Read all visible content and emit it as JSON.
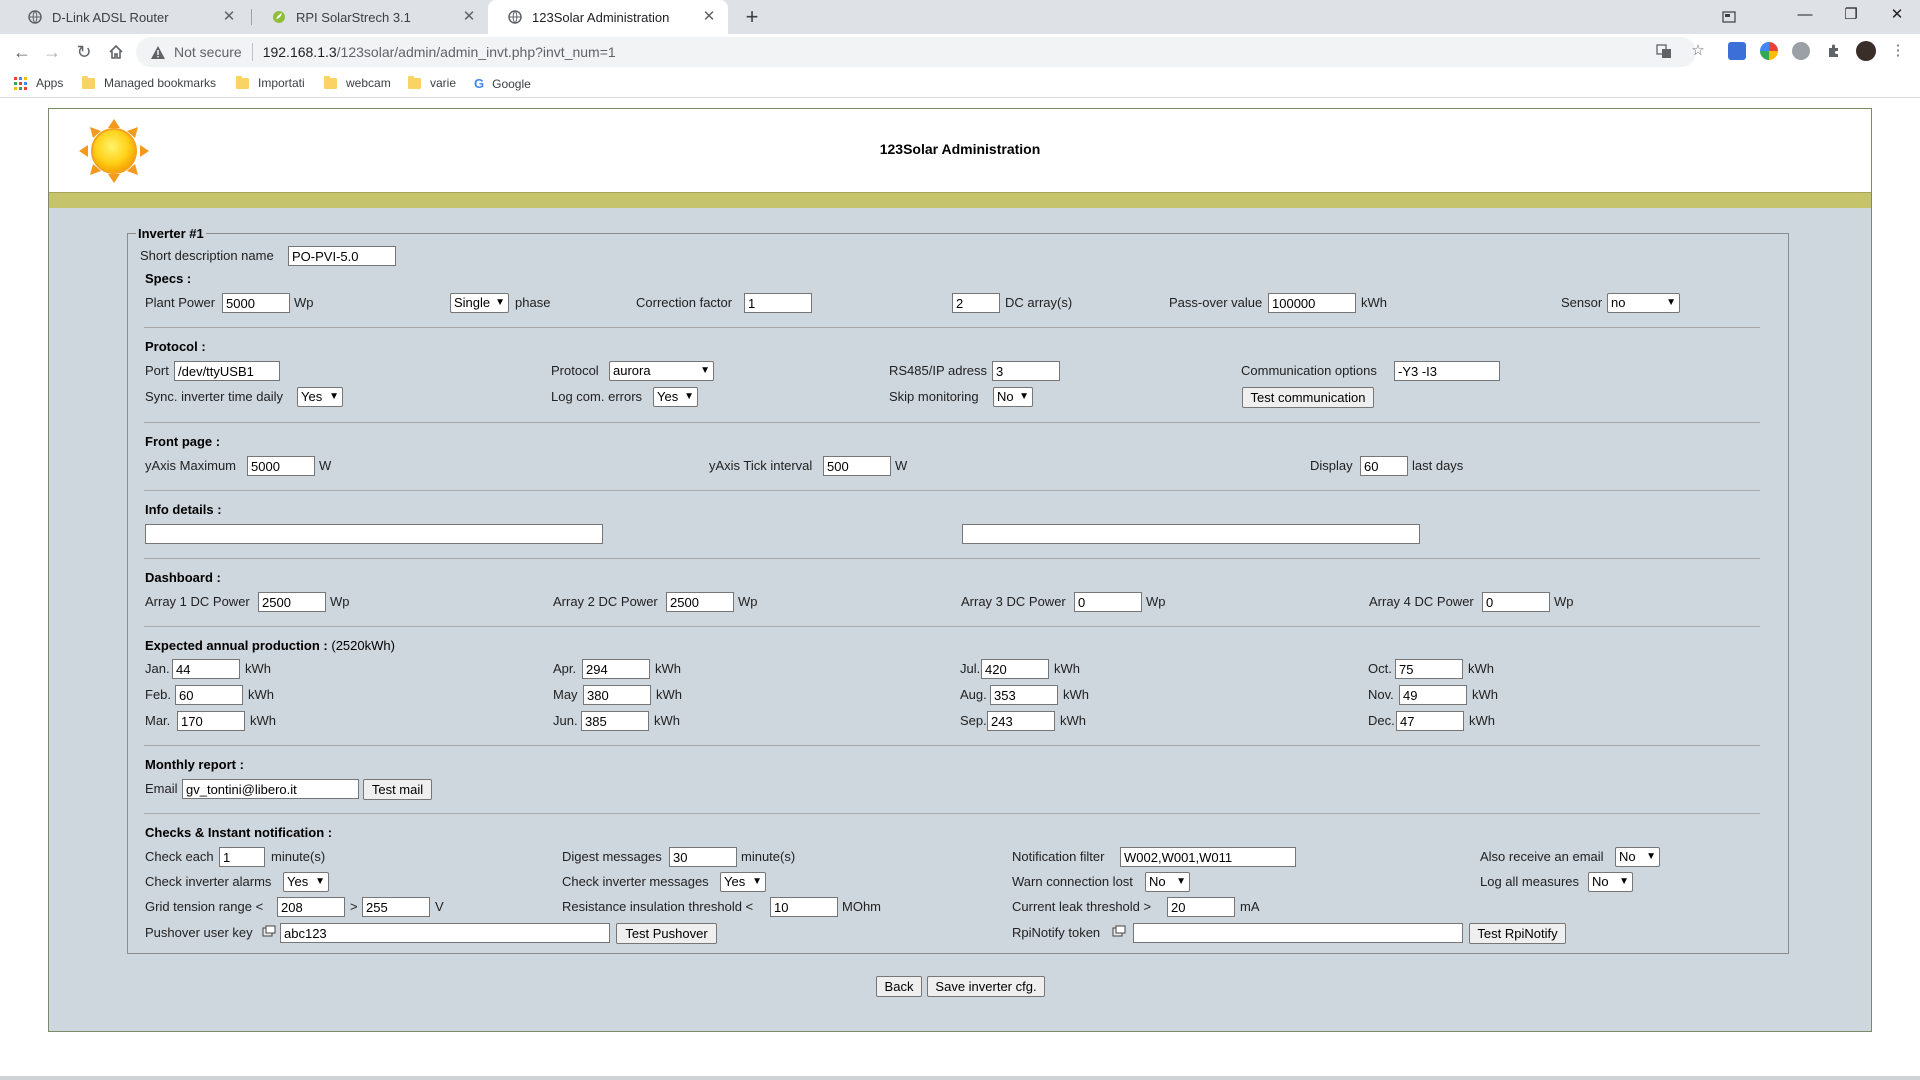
{
  "browser": {
    "tabs": [
      {
        "title": "D-Link ADSL Router",
        "active": false
      },
      {
        "title": "RPI SolarStrech 3.1",
        "active": false
      },
      {
        "title": "123Solar Administration",
        "active": true
      }
    ],
    "address": {
      "security": "Not secure",
      "host": "192.168.1.3",
      "path": "/123solar/admin/admin_invt.php?invt_num=1"
    },
    "bookmarks": [
      "Apps",
      "Managed bookmarks",
      "Importati",
      "webcam",
      "varie",
      "Google"
    ]
  },
  "page": {
    "title": "123Solar Administration",
    "legend": "Inverter #1",
    "short_desc": {
      "label": "Short description name",
      "value": "PO-PVI-5.0"
    },
    "specs": {
      "title": "Specs :",
      "plant_power_label": "Plant Power",
      "plant_power": "5000",
      "plant_power_unit": "Wp",
      "phase_value": "Single",
      "phase_label": "phase",
      "correction_label": "Correction factor",
      "correction": "1",
      "dc_arrays": "2",
      "dc_arrays_label": "DC array(s)",
      "passover_label": "Pass-over value",
      "passover": "100000",
      "passover_unit": "kWh",
      "sensor_label": "Sensor",
      "sensor": "no"
    },
    "protocol": {
      "title": "Protocol :",
      "port_label": "Port",
      "port": "/dev/ttyUSB1",
      "protocol_label": "Protocol",
      "protocol": "aurora",
      "rs485_label": "RS485/IP adress",
      "rs485": "3",
      "comm_label": "Communication options",
      "comm": "-Y3 -I3",
      "sync_label": "Sync. inverter time daily",
      "sync": "Yes",
      "log_label": "Log com. errors",
      "log": "Yes",
      "skip_label": "Skip monitoring",
      "skip": "No",
      "test_button": "Test communication"
    },
    "front": {
      "title": "Front page :",
      "ymax_label": "yAxis Maximum",
      "ymax": "5000",
      "ymax_unit": "W",
      "ytick_label": "yAxis Tick interval",
      "ytick": "500",
      "ytick_unit": "W",
      "display_label": "Display",
      "display": "60",
      "display_unit": "last days"
    },
    "info": {
      "title": "Info details :",
      "field1": "",
      "field2": ""
    },
    "dashboard": {
      "title": "Dashboard :",
      "arrays": [
        {
          "label": "Array 1 DC Power",
          "value": "2500",
          "unit": "Wp"
        },
        {
          "label": "Array 2 DC Power",
          "value": "2500",
          "unit": "Wp"
        },
        {
          "label": "Array 3 DC Power",
          "value": "0",
          "unit": "Wp"
        },
        {
          "label": "Array 4 DC Power",
          "value": "0",
          "unit": "Wp"
        }
      ]
    },
    "production": {
      "title": "Expected annual production :",
      "total": "(2520kWh)",
      "unit": "kWh",
      "months": [
        {
          "label": "Jan.",
          "value": "44"
        },
        {
          "label": "Feb.",
          "value": "60"
        },
        {
          "label": "Mar.",
          "value": "170"
        },
        {
          "label": "Apr.",
          "value": "294"
        },
        {
          "label": "May",
          "value": "380"
        },
        {
          "label": "Jun.",
          "value": "385"
        },
        {
          "label": "Jul.",
          "value": "420"
        },
        {
          "label": "Aug.",
          "value": "353"
        },
        {
          "label": "Sep.",
          "value": "243"
        },
        {
          "label": "Oct.",
          "value": "75"
        },
        {
          "label": "Nov.",
          "value": "49"
        },
        {
          "label": "Dec.",
          "value": "47"
        }
      ]
    },
    "monthly": {
      "title": "Monthly report :",
      "email_label": "Email",
      "email": "gv_tontini@libero.it",
      "test_button": "Test mail"
    },
    "checks": {
      "title": "Checks & Instant notification :",
      "check_each_label": "Check each",
      "check_each": "1",
      "check_each_unit": "minute(s)",
      "digest_label": "Digest messages",
      "digest": "30",
      "digest_unit": "minute(s)",
      "filter_label": "Notification filter",
      "filter": "W002,W001,W011",
      "also_email_label": "Also receive an email",
      "also_email": "No",
      "alarms_label": "Check inverter alarms",
      "alarms": "Yes",
      "messages_label": "Check inverter messages",
      "messages": "Yes",
      "conn_lost_label": "Warn connection lost",
      "conn_lost": "No",
      "log_all_label": "Log all measures",
      "log_all": "No",
      "grid_label": "Grid tension range <",
      "grid_min": "208",
      "grid_gt": ">",
      "grid_max": "255",
      "grid_unit": "V",
      "resistance_label": "Resistance insulation threshold <",
      "resistance": "10",
      "resistance_unit": "MOhm",
      "leak_label": "Current leak threshold >",
      "leak": "20",
      "leak_unit": "mA",
      "pushover_label": "Pushover user key",
      "pushover": "abc123",
      "pushover_button": "Test Pushover",
      "rpinotify_label": "RpiNotify token",
      "rpinotify": "",
      "rpinotify_button": "Test RpiNotify"
    },
    "actions": {
      "back": "Back",
      "save": "Save inverter cfg."
    }
  }
}
